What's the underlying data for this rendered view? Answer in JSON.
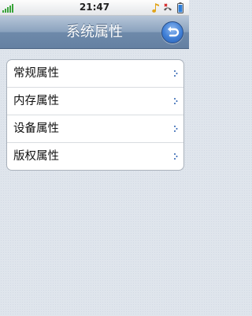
{
  "status_bar": {
    "time": "21:47",
    "icons": [
      "signal-icon",
      "music-note-icon",
      "missed-call-icon",
      "battery-icon"
    ]
  },
  "header": {
    "title": "系统属性",
    "back_icon": "back-arrow-icon"
  },
  "menu": {
    "items": [
      {
        "label": "常规属性"
      },
      {
        "label": "内存属性"
      },
      {
        "label": "设备属性"
      },
      {
        "label": "版权属性"
      }
    ]
  },
  "colors": {
    "title_bar": "#7a93b2",
    "back_button": "#3f7fd6",
    "signal": "#3aa43a",
    "chevron": "#2a5fb0"
  }
}
